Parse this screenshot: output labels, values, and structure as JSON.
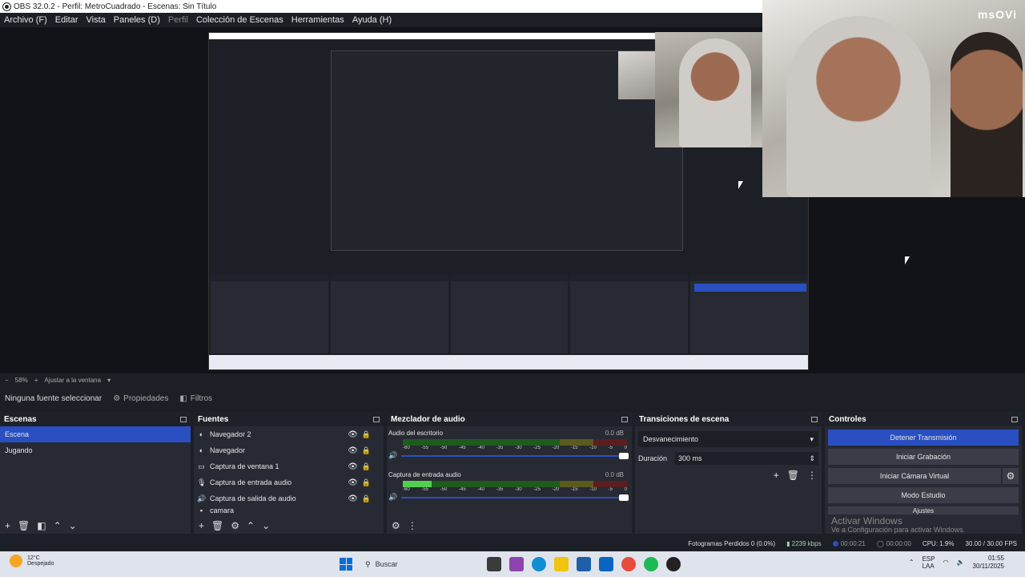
{
  "window": {
    "title": "OBS 32.0.2 - Perfil: MetroCuadrado - Escenas: Sin Título"
  },
  "menu": [
    "Archivo (F)",
    "Editar",
    "Vista",
    "Paneles (D)",
    "Perfil",
    "Colección de Escenas",
    "Herramientas",
    "Ayuda (H)"
  ],
  "watermark": "msOVi",
  "zoom": {
    "value": "58%",
    "fit": "Ajustar a la ventana"
  },
  "source_toolbar": {
    "no_source": "Ninguna fuente seleccionar",
    "properties": "Propiedades",
    "filters": "Filtros"
  },
  "docks": {
    "scenes": {
      "title": "Escenas",
      "items": [
        "Escena",
        "Jugando"
      ]
    },
    "sources": {
      "title": "Fuentes",
      "items": [
        "Navegador 2",
        "Navegador",
        "Captura de ventana 1",
        "Captura de entrada audio",
        "Captura de salida de audio",
        "camara"
      ]
    },
    "mixer": {
      "title": "Mezclador de audio",
      "channels": [
        {
          "name": "Audio del escritorio",
          "db": "0.0 dB",
          "level": 0
        },
        {
          "name": "Captura de entrada audio",
          "db": "0.0 dB",
          "level": 0.13
        }
      ],
      "ticks": [
        "-60",
        "-55",
        "-50",
        "-45",
        "-40",
        "-35",
        "-30",
        "-25",
        "-20",
        "-15",
        "-10",
        "-5",
        "0"
      ]
    },
    "transitions": {
      "title": "Transiciones de escena",
      "selected": "Desvanecimiento",
      "duration_label": "Duración",
      "duration_value": "300 ms"
    },
    "controls": {
      "title": "Controles",
      "buttons": [
        "Detener Transmisión",
        "Iniciar Grabación",
        "Iniciar Cámara Virtual",
        "Modo Estudio",
        "Ajustes"
      ],
      "activate_title": "Activar Windows",
      "activate_sub": "Ve a Configuración para activar Windows."
    }
  },
  "status": {
    "dropped": "Fotogramas Perdidos 0 (0.0%)",
    "kbps": "2239 kbps",
    "stream_time": "00:00:21",
    "rec_time": "00:00:00",
    "cpu": "CPU: 1.9%",
    "fps": "30.00 / 30.00 FPS"
  },
  "taskbar": {
    "weather_temp": "12°C",
    "weather_desc": "Despejado",
    "search": "Buscar",
    "lang": "ESP",
    "lang2": "LAA",
    "time": "01:55",
    "date": "30/11/2025"
  },
  "colors": {
    "accent": "#2a4fc1",
    "bg": "#1d1f26",
    "panel": "#272a33"
  }
}
